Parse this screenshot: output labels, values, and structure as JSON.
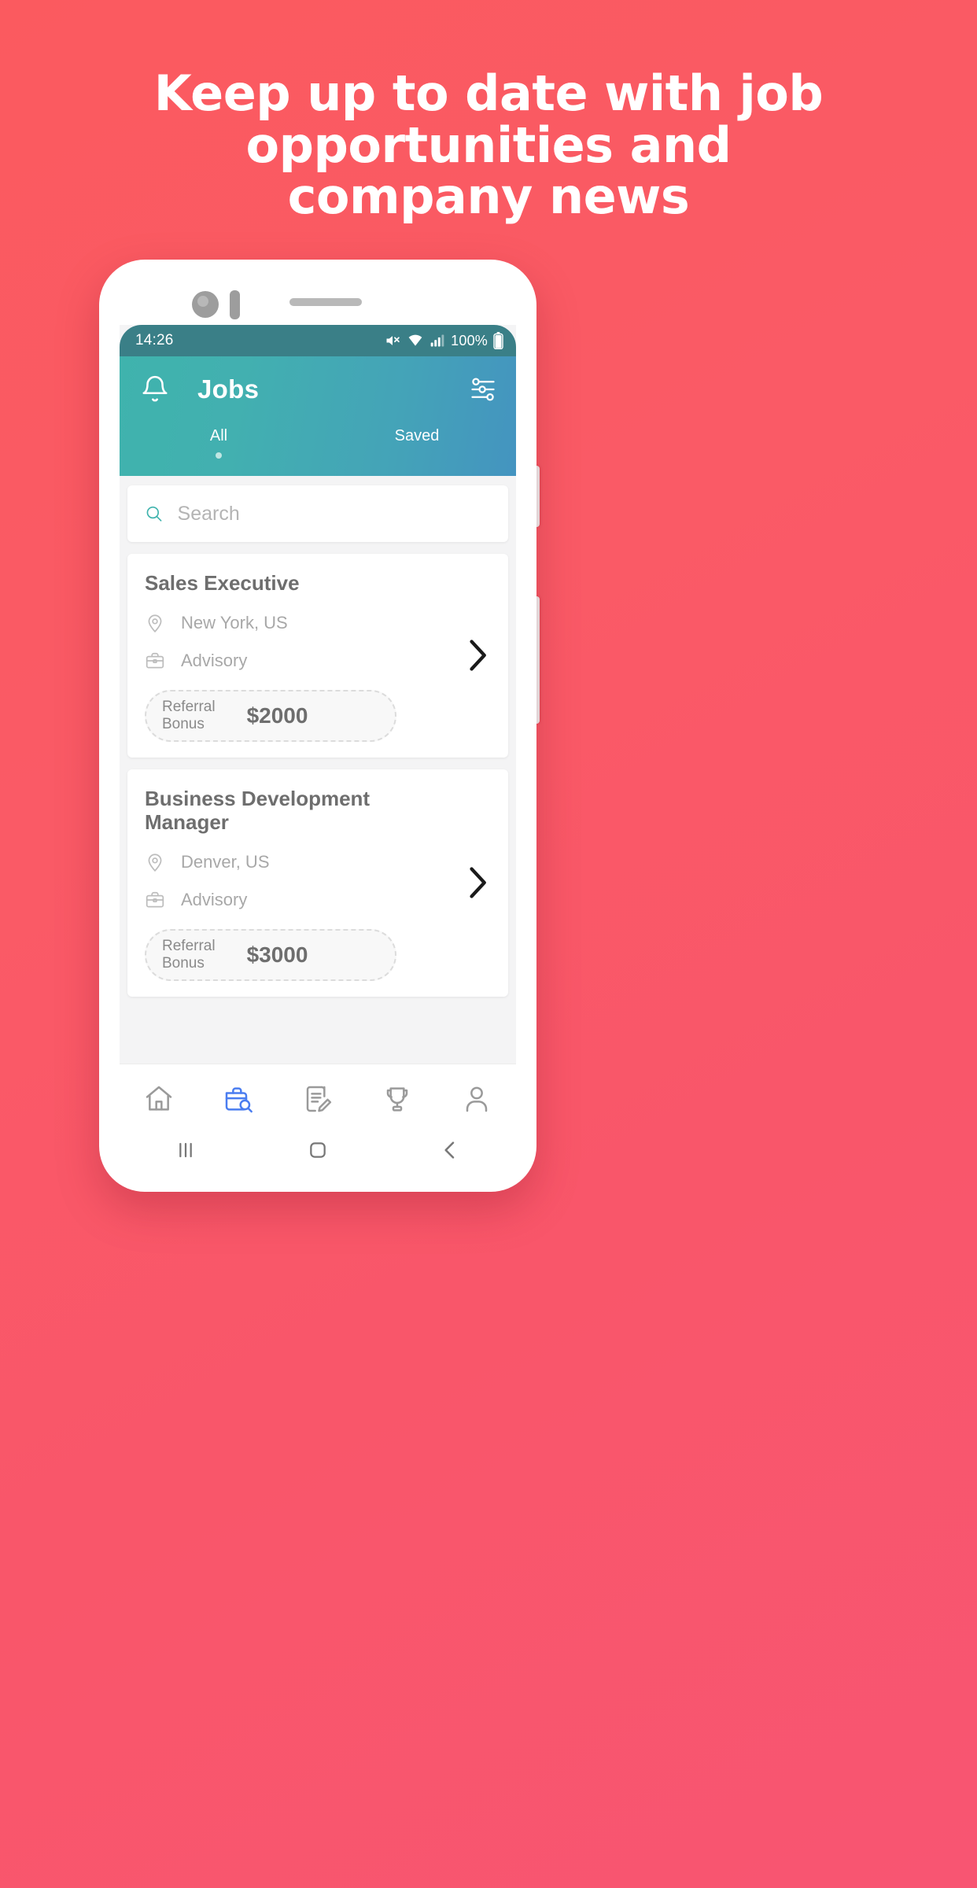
{
  "promo": {
    "headline": "Keep up to date with job\nopportunities and\ncompany news",
    "background_color": "#fb5a66",
    "headline_color": "#ffffff"
  },
  "phone": {
    "statusbar": {
      "time": "14:26",
      "battery_percent": "100%",
      "icons": [
        "mute-icon",
        "wifi-icon",
        "signal-icon",
        "battery-icon"
      ],
      "background_color": "#3a7f87"
    },
    "appbar": {
      "bell_icon": "bell-icon",
      "title": "Jobs",
      "filter_icon": "filter-sliders-icon",
      "gradient_from": "#3fb3ad",
      "gradient_to": "#4494c0"
    },
    "tabs": [
      {
        "label": "All",
        "active": true
      },
      {
        "label": "Saved",
        "active": false
      }
    ],
    "search": {
      "placeholder": "Search",
      "value": "",
      "icon": "search-icon",
      "icon_color": "#3fb3ad"
    },
    "jobs": [
      {
        "title": "Sales Executive",
        "location": "New York, US",
        "location_icon": "location-pin-icon",
        "department": "Advisory",
        "department_icon": "briefcase-icon",
        "bonus_label": "Referral\nBonus",
        "bonus_amount": "$2000",
        "chevron_icon": "chevron-right-icon"
      },
      {
        "title": "Business Development Manager",
        "location": "Denver, US",
        "location_icon": "location-pin-icon",
        "department": "Advisory",
        "department_icon": "briefcase-icon",
        "bonus_label": "Referral\nBonus",
        "bonus_amount": "$3000",
        "chevron_icon": "chevron-right-icon"
      }
    ],
    "bottom_nav": [
      {
        "name": "home-icon",
        "active": false
      },
      {
        "name": "job-search-icon",
        "active": true
      },
      {
        "name": "document-edit-icon",
        "active": false
      },
      {
        "name": "trophy-icon",
        "active": false
      },
      {
        "name": "profile-icon",
        "active": false
      }
    ],
    "bottom_nav_active_color": "#4a7df0",
    "bottom_nav_inactive_color": "#9a9a9a",
    "system_nav": [
      {
        "name": "recents-icon"
      },
      {
        "name": "home-square-icon"
      },
      {
        "name": "back-icon"
      }
    ]
  }
}
